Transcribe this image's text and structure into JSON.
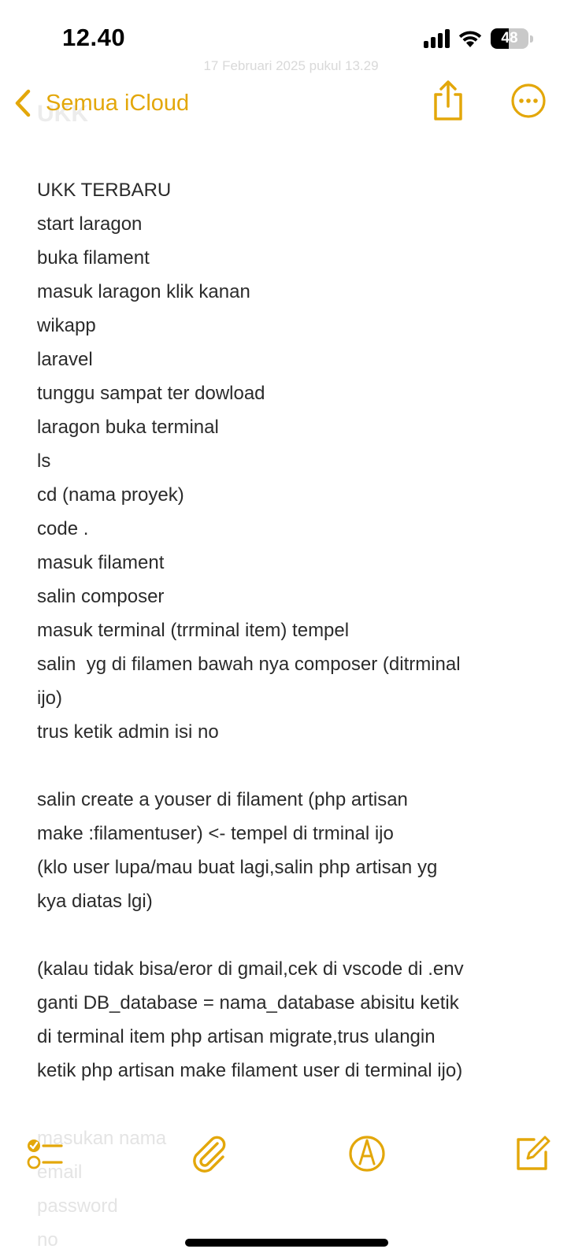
{
  "status_bar": {
    "time": "12.40",
    "battery_level": "48",
    "battery_percent": 48,
    "icons": [
      "cellular-signal-icon",
      "wifi-icon",
      "battery-icon"
    ]
  },
  "faded": {
    "date": "17 Februari 2025 pukul 13.29",
    "title": "UKK"
  },
  "nav": {
    "back_label": "Semua iCloud",
    "share_icon": "share-icon",
    "more_icon": "more-options-icon"
  },
  "note": {
    "lines": [
      "UKK TERBARU",
      "start laragon",
      "buka filament",
      "masuk laragon klik kanan",
      "wikapp",
      "laravel",
      "tunggu sampat ter dowload",
      "laragon buka terminal",
      "ls",
      "cd (nama proyek)",
      "code .",
      "masuk filament",
      "salin composer",
      "masuk terminal (trrminal item) tempel",
      "salin  yg di filamen bawah nya composer (ditrminal",
      "ijo)",
      "trus ketik admin isi no",
      "",
      "salin create a youser di filament (php artisan",
      "make :filamentuser) <- tempel di trminal ijo",
      "(klo user lupa/mau buat lagi,salin php artisan yg",
      "kya diatas lgi)",
      "",
      "(kalau tidak bisa/eror di gmail,cek di vscode di .env",
      "ganti DB_database = nama_database abisitu ketik",
      "di terminal item php artisan migrate,trus ulangin",
      "ketik php artisan make filament user di terminal ijo)"
    ],
    "tail_lines": [
      "masukan nama",
      "email",
      "password",
      "no"
    ]
  },
  "toolbar": {
    "icons": [
      "checklist-icon",
      "attachment-icon",
      "markup-icon",
      "compose-icon"
    ]
  },
  "colors": {
    "accent": "#e3a70a",
    "text": "#2b2b2b",
    "background": "#ffffff"
  }
}
